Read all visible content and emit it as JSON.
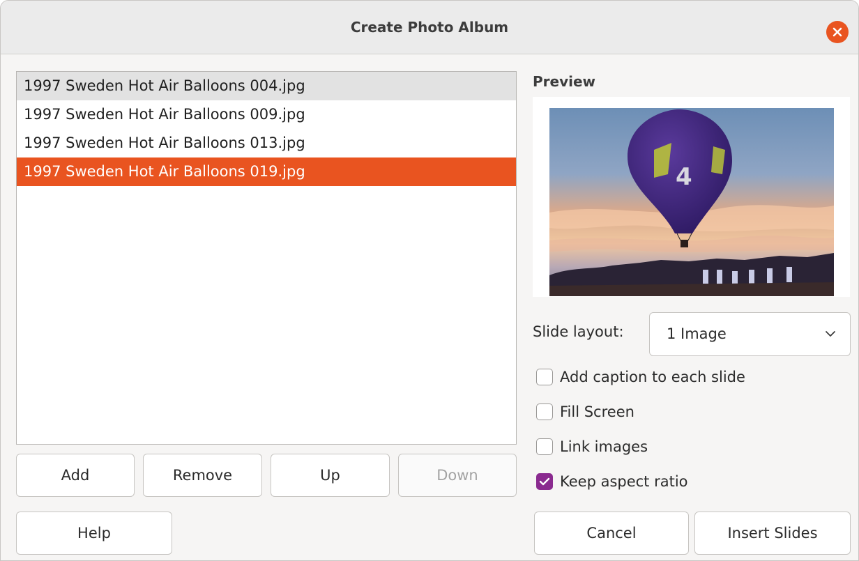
{
  "window": {
    "title": "Create Photo Album"
  },
  "file_list": {
    "items": [
      {
        "label": "1997 Sweden Hot Air Balloons 004.jpg",
        "state": "highlighted"
      },
      {
        "label": "1997 Sweden Hot Air Balloons 009.jpg",
        "state": "normal"
      },
      {
        "label": "1997 Sweden Hot Air Balloons 013.jpg",
        "state": "normal"
      },
      {
        "label": "1997 Sweden Hot Air Balloons 019.jpg",
        "state": "selected"
      }
    ]
  },
  "list_buttons": {
    "add": "Add",
    "remove": "Remove",
    "up": "Up",
    "down": "Down"
  },
  "preview": {
    "label": "Preview"
  },
  "options": {
    "slide_layout_label": "Slide layout:",
    "slide_layout_value": "1 Image",
    "add_caption": {
      "label": "Add caption to each slide",
      "checked": false
    },
    "fill_screen": {
      "label": "Fill Screen",
      "checked": false
    },
    "link_images": {
      "label": "Link images",
      "checked": false
    },
    "keep_aspect": {
      "label": "Keep aspect ratio",
      "checked": true
    }
  },
  "footer": {
    "help": "Help",
    "cancel": "Cancel",
    "insert": "Insert Slides"
  },
  "colors": {
    "accent": "#e95420",
    "checkbox_checked": "#8a2a8f"
  }
}
